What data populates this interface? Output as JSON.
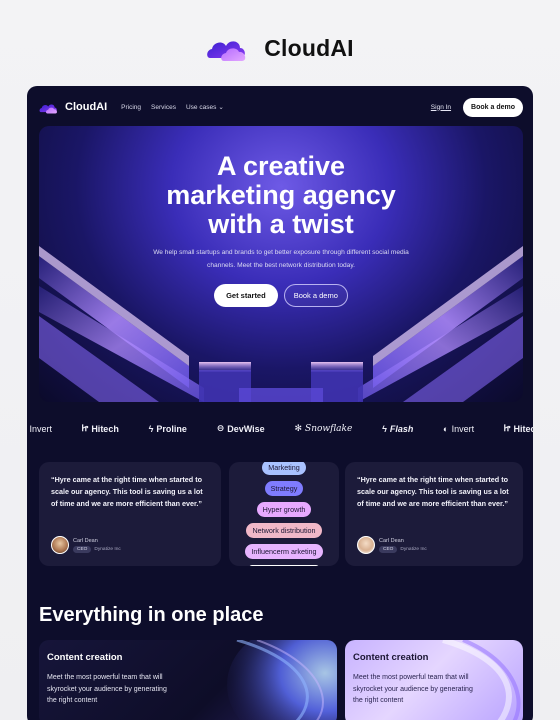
{
  "brand": {
    "name": "CloudAI"
  },
  "nav": {
    "links": [
      "Pricing",
      "Services",
      "Use cases"
    ],
    "sign_in": "Sign In",
    "cta": "Book a demo"
  },
  "hero": {
    "title_lines": [
      "A creative",
      "marketing agency",
      "with a twist"
    ],
    "subtitle": "We help small startups and brands to get better exposure through different social media channels. Meet the best network distribution today.",
    "primary": "Get started",
    "secondary": "Book a demo"
  },
  "logos": [
    "Invert",
    "Hitech",
    "Proline",
    "DevWise",
    "Snowflake",
    "Flash",
    "Invert",
    "Hitech"
  ],
  "testimonials": [
    {
      "quote": "“Hyre came at the right time when started to scale our agency. This tool is saving us a lot of time and we are more efficient than ever.”",
      "name": "Carl Dean",
      "role": "CEO",
      "company": "Dynatize Inc"
    },
    {
      "quote": "“Hyre came at the right time when started to scale our agency. This tool is saving us a lot of time and we are more efficient than ever.”",
      "name": "Carl Dean",
      "role": "CEO",
      "company": "Dynatize Inc"
    }
  ],
  "tags": [
    {
      "label": "Marketing",
      "color": "#a9c2ff"
    },
    {
      "label": "Strategy",
      "color": "#7f7cff"
    },
    {
      "label": "Hyper growth",
      "color": "#e7a9ff"
    },
    {
      "label": "Network distribution",
      "color": "#f1b8c8"
    },
    {
      "label": "Influencerm arketing",
      "color": "#e7b4ff"
    },
    {
      "label": "",
      "color": "#ffffff"
    }
  ],
  "section": {
    "title": "Everything in one place"
  },
  "features": [
    {
      "title": "Content creation",
      "text": "Meet the most powerful team that will skyrocket your audience by generating the right content"
    },
    {
      "title": "Content creation",
      "text": "Meet the most powerful team that will skyrocket your audience by generating the right content"
    }
  ],
  "colors": {
    "frame": "#0d0d2b",
    "accent": "#6e5ae6",
    "card": "#1c1b3a"
  }
}
